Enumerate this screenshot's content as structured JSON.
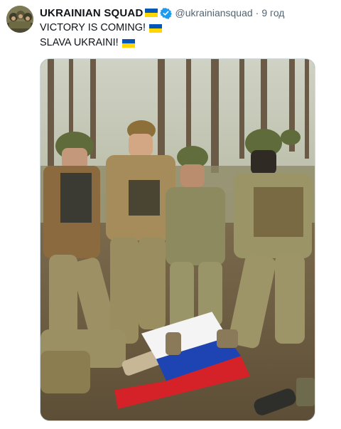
{
  "tweet": {
    "author_name": "UKRAINIAN SQUAD",
    "handle": "@ukrainiansquad",
    "separator": "·",
    "time": "9 год",
    "lines": [
      "VICTORY IS COMING!",
      "SLAVA UKRAINI!"
    ]
  },
  "icons": {
    "flag": "ukraine-flag-icon",
    "verified": "verified-badge-icon"
  },
  "colors": {
    "flag_blue": "#0057b7",
    "flag_yellow": "#ffd700",
    "verified_blue": "#1d9bf0",
    "text_primary": "#0f1419",
    "text_secondary": "#536471"
  }
}
